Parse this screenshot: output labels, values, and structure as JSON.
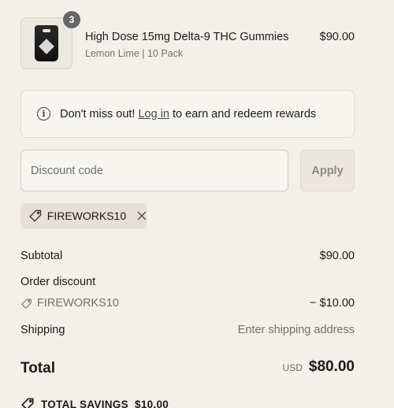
{
  "line_item": {
    "quantity": "3",
    "title": "High Dose 15mg Delta-9 THC Gummies",
    "variant": "Lemon Lime | 10 Pack",
    "price": "$90.00",
    "image_icon": "product-bag-thumbnail"
  },
  "rewards_banner": {
    "prefix": "Don't miss out! ",
    "link_text": "Log in",
    "suffix": " to earn and redeem rewards",
    "icon": "info-icon"
  },
  "discount": {
    "placeholder": "Discount code",
    "apply_label": "Apply",
    "applied_code": "FIREWORKS10"
  },
  "summary": {
    "subtotal_label": "Subtotal",
    "subtotal_value": "$90.00",
    "order_discount_label": "Order discount",
    "discount_code": "FIREWORKS10",
    "discount_value": "− $10.00",
    "shipping_label": "Shipping",
    "shipping_value": "Enter shipping address",
    "total_label": "Total",
    "currency": "USD",
    "total_value": "$80.00",
    "savings_text": "TOTAL SAVINGS  $10.00"
  }
}
